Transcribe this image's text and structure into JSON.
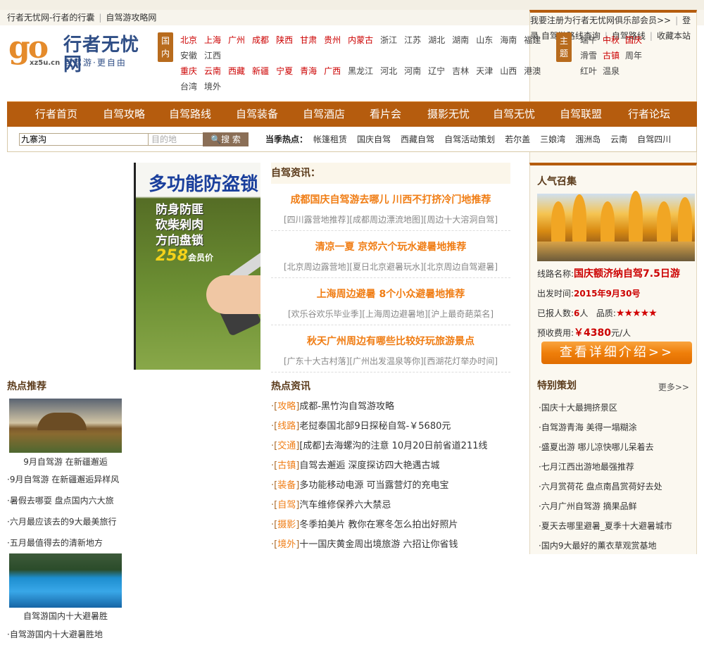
{
  "topbar": {
    "left_links": [
      "行者无忧网-行者的行囊",
      "自驾游攻略网"
    ],
    "right_links": [
      "我要注册为行者无忧网俱乐部会员>>",
      "登录",
      "自驾游路线查询",
      "自驾路线",
      "收藏本站"
    ]
  },
  "logo": {
    "mark": "go",
    "name": "行者无忧网",
    "slogan": "自驾游·更自由",
    "domain": "xz5u.cn"
  },
  "domestic": {
    "tag": "国内",
    "red": [
      "北京",
      "上海",
      "广州",
      "成都",
      "陕西",
      "甘肃",
      "贵州",
      "内蒙古"
    ],
    "dark1": [
      "浙江",
      "江苏",
      "湖北",
      "湖南",
      "山东",
      "海南",
      "福建",
      "安徽",
      "江西"
    ],
    "red2": [
      "重庆",
      "云南",
      "西藏",
      "新疆",
      "宁夏",
      "青海",
      "广西"
    ],
    "dark2": [
      "黑龙江",
      "河北",
      "河南",
      "辽宁",
      "吉林",
      "天津",
      "山西",
      "港澳",
      "台湾",
      "境外"
    ]
  },
  "themes": {
    "tag": "主题",
    "rows": [
      [
        {
          "t": "端午",
          "c": "dark"
        },
        {
          "t": "中秋",
          "c": "red"
        },
        {
          "t": "国庆",
          "c": "red"
        }
      ],
      [
        {
          "t": "滑雪",
          "c": "dark"
        },
        {
          "t": "古镇",
          "c": "red"
        },
        {
          "t": "周年",
          "c": "dark"
        }
      ],
      [
        {
          "t": "红叶",
          "c": "dark"
        },
        {
          "t": "温泉",
          "c": "dark"
        }
      ]
    ]
  },
  "nav": [
    "行者首页",
    "自驾攻略",
    "自驾路线",
    "自驾装备",
    "自驾酒店",
    "看片会",
    "摄影无忧",
    "自驾无忧",
    "自驾联盟",
    "行者论坛"
  ],
  "search": {
    "keyword": "九寨沟",
    "dest_placeholder": "目的地",
    "button": "搜 索",
    "hot_label": "当季热点：",
    "hot": [
      "帐篷租赁",
      "国庆自驾",
      "西藏自驾",
      "自驾活动策划",
      "若尔盖",
      "三娘湾",
      "涠洲岛",
      "云南",
      "自驾四川"
    ]
  },
  "banner": {
    "title": "多功能防盗锁",
    "lines": [
      "防身防匪",
      "砍柴剁肉",
      "方向盘锁"
    ],
    "price": "258",
    "price_suffix": "会员价"
  },
  "news": {
    "heading": "自驾资讯：",
    "items": [
      {
        "title": "成都国庆自驾游去哪儿 川西不打挤冷门地推荐",
        "sub": "[四川露营地推荐][成都周边漂流地图][周边十大溶洞自驾]"
      },
      {
        "title": "清凉一夏 京郊六个玩水避暑地推荐",
        "sub": "[北京周边露营地][夏日北京避暑玩水][北京周边自驾避暑]"
      },
      {
        "title": "上海周边避暑 8个小众避暑地推荐",
        "sub": "[欢乐谷欢乐毕业季][上海周边避暑地][沪上最奇葩菜名]"
      },
      {
        "title": "秋天广州周边有哪些比较好玩旅游景点",
        "sub": "[广东十大古村落][广州出发温泉等你][西湖花灯举办时间]"
      }
    ]
  },
  "hot_news": {
    "heading": "热点资讯",
    "rows": [
      {
        "cat": "攻略",
        "text": "成都-黑竹沟自驾游攻略"
      },
      {
        "cat": "线路",
        "text": "老挝泰国北部9日探秘自驾-￥5680元"
      },
      {
        "cat": "交通",
        "text": "[成都]去海螺沟的注意 10月20日前省道211线"
      },
      {
        "cat": "古镇",
        "text": "自驾去邂逅 深度探访四大艳遇古城"
      },
      {
        "cat": "装备",
        "text": "多功能移动电源 可当露营灯的充电宝"
      },
      {
        "cat": "自驾",
        "text": "汽车维修保养六大禁忌"
      },
      {
        "cat": "摄影",
        "text": "冬季拍美片 教你在寒冬怎么拍出好照片"
      },
      {
        "cat": "境外",
        "text": "十一国庆黄金周出境旅游 六招让你省钱"
      }
    ]
  },
  "left": {
    "heading": "热点推荐",
    "caption1": "9月自驾游 在新疆邂逅",
    "list1": [
      "·9月自驾游 在新疆邂逅异样风",
      "·暑假去哪耍 盘点国内六大旅",
      "·六月最应该去的9大最美旅行",
      "·五月最值得去的清新地方"
    ],
    "caption2": "自驾游国内十大避暑胜",
    "list2": [
      "·自驾游国内十大避暑胜地"
    ]
  },
  "right": {
    "heading1": "人气召集",
    "route_label": "线路名称:",
    "route_value": "国庆额济纳自驾7.5日游",
    "date_label": "出发时间:",
    "date_value": "2015年9月30号",
    "count_label": "已报人数:",
    "count_value": "6",
    "count_unit": "人",
    "quality_label": "品质:",
    "stars": "★★★★★",
    "fee_label": "预收费用:",
    "fee_value": "￥4380",
    "fee_unit": "元/人",
    "detail_button": "查看详细介绍>>",
    "heading2": "特别策划",
    "more": "更多>>",
    "plans": [
      "·国庆十大最拥挤景区",
      "·自驾游青海 美得一塌糊涂",
      "·盛夏出游 哪儿凉快哪儿呆着去",
      "·七月江西出游地最强推荐",
      "·六月赏荷花 盘点南昌赏荷好去处",
      "·六月广州自驾游 摘果品鲜",
      "·夏天去哪里避暑_夏季十大避暑城市",
      "·国内9大最好的薰衣草观赏基地"
    ]
  }
}
